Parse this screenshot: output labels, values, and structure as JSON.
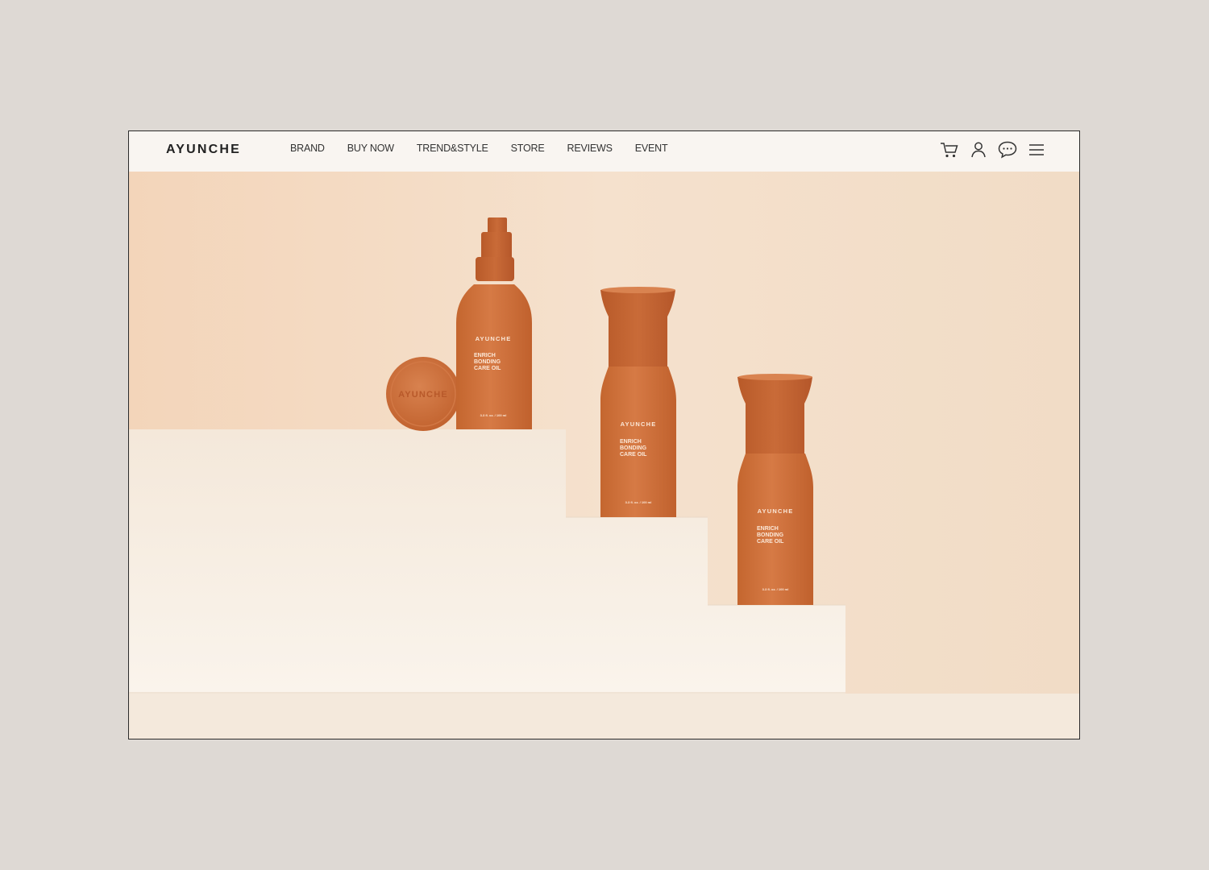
{
  "nav": {
    "logo": "AYUNCHE",
    "items": [
      {
        "label": "BRAND"
      },
      {
        "label": "BUY NOW"
      },
      {
        "label": "TREND&STYLE"
      },
      {
        "label": "STORE"
      },
      {
        "label": "REVIEWS"
      },
      {
        "label": "EVENT"
      }
    ],
    "icons": [
      "cart-icon",
      "user-icon",
      "chat-icon",
      "menu-icon"
    ]
  },
  "hero": {
    "cap_text": "AYUNCHE",
    "bottles": [
      {
        "brand": "AYUNCHE",
        "name_line1": "ENRICH",
        "name_line2": "BONDING",
        "name_line3": "CARE OIL",
        "volume": "3.3 fl. oz. / 100 ml"
      },
      {
        "brand": "AYUNCHE",
        "name_line1": "ENRICH",
        "name_line2": "BONDING",
        "name_line3": "CARE OIL",
        "volume": "3.3 fl. oz. / 100 ml"
      },
      {
        "brand": "AYUNCHE",
        "name_line1": "ENRICH",
        "name_line2": "BONDING",
        "name_line3": "CARE OIL",
        "volume": "3.3 fl. oz. / 100 ml"
      }
    ]
  },
  "colors": {
    "page_bg": "#ded9d4",
    "nav_bg": "#f9f5f1",
    "hero_bg": "#f3e1cc",
    "bottle": "#cf7240",
    "steps": "#f6eee5"
  }
}
